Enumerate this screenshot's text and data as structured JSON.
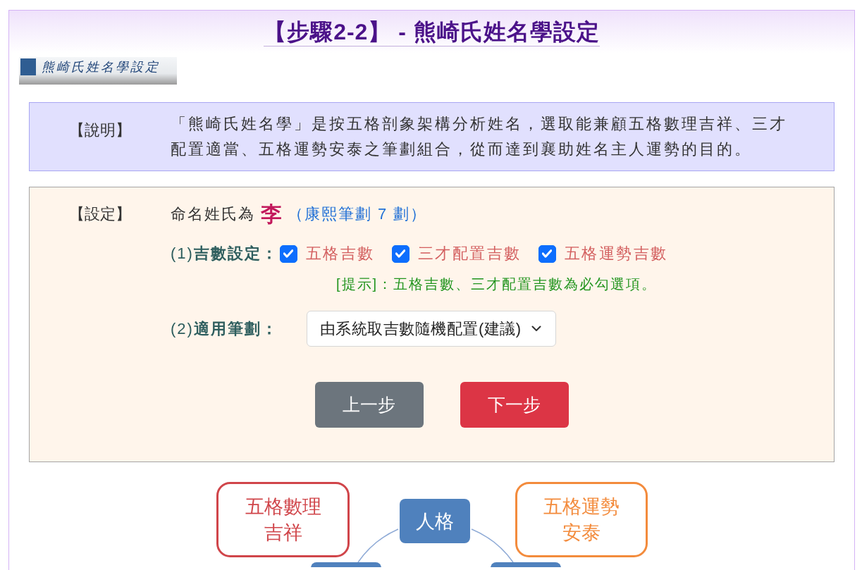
{
  "page": {
    "title": "【步驟2-2】 - 熊崎氏姓名學設定",
    "banner": "熊崎氏姓名學設定",
    "description": {
      "label": "【說明】",
      "text": "「熊崎氏姓名學」是按五格剖象架構分析姓名，選取能兼顧五格數理吉祥、三才配置適當、五格運勢安泰之筆劃組合，從而達到襄助姓名主人運勢的目的。"
    },
    "settings": {
      "label": "【設定】",
      "surname_prefix": "命名姓氏為",
      "surname": "李",
      "strokes_note": "（康熙筆劃 7 劃）",
      "lucky_numbers": {
        "label": "(1)**吉數設定：**",
        "options": [
          {
            "label": "五格吉數",
            "checked": true
          },
          {
            "label": "三才配置吉數",
            "checked": true
          },
          {
            "label": "五格運勢吉數",
            "checked": true
          }
        ]
      },
      "hint": "[提示]：五格吉數、三才配置吉數為必勾選項。",
      "strokes": {
        "label": "(2)**適用筆劃：**",
        "value": "由系統取吉數隨機配置(建議)"
      },
      "buttons": [
        {
          "label": "上一步",
          "kind": "secondary"
        },
        {
          "label": "下一步",
          "kind": "primary"
        }
      ]
    },
    "diagram": {
      "nodes": [
        {
          "kind": "outline",
          "color": "#d0454a",
          "lines": [
            "五格數理",
            "吉祥"
          ]
        },
        {
          "kind": "filled",
          "color": "#4f81bd",
          "lines": [
            "人格"
          ]
        },
        {
          "kind": "outline",
          "color": "#f38b3c",
          "lines": [
            "五格運勢",
            "安泰"
          ]
        },
        {
          "kind": "filled",
          "color": "#4f81bd"
        },
        {
          "kind": "filled",
          "color": "#4f81bd"
        }
      ]
    }
  }
}
